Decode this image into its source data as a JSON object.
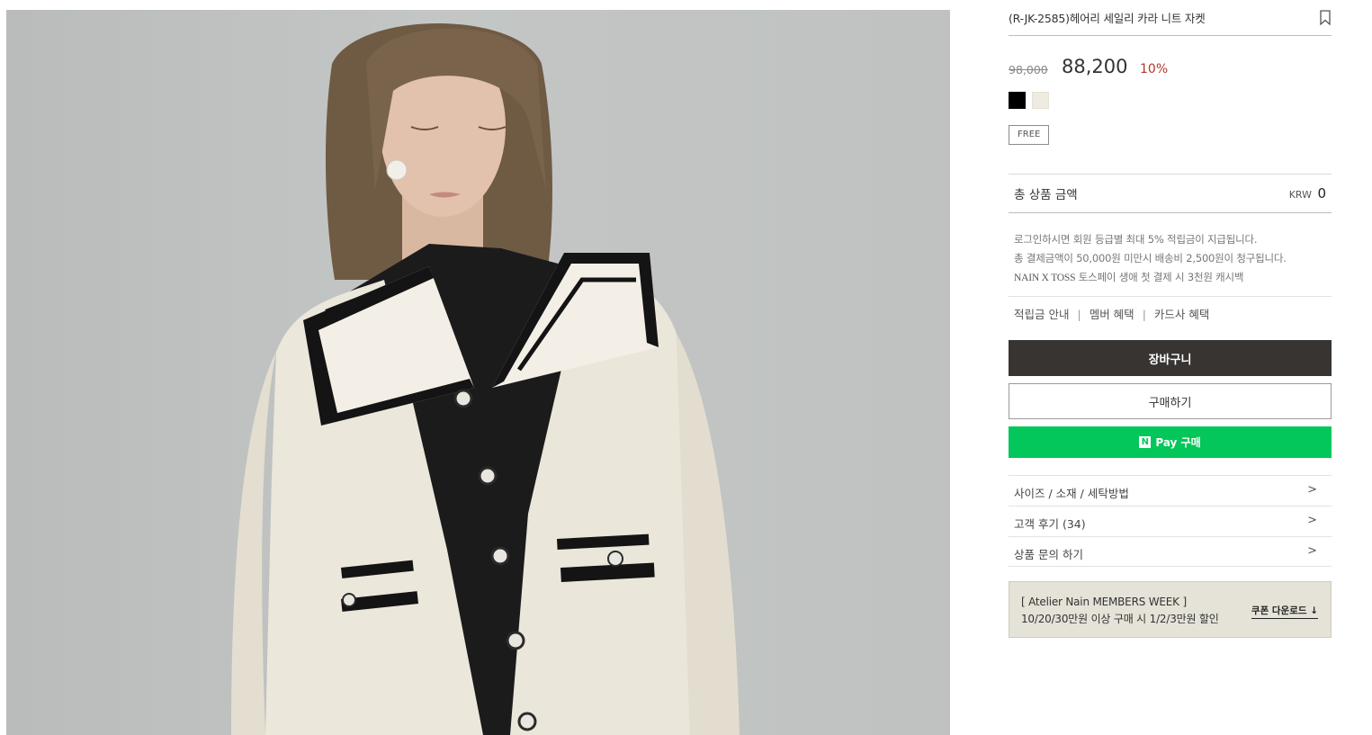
{
  "product": {
    "title": "(R-JK-2585)헤어리 세일리 카라 니트 자켓",
    "price_original": "98,000",
    "price_sale": "88,200",
    "discount": "10%",
    "colors": [
      {
        "name": "black",
        "hex": "#000000"
      },
      {
        "name": "ivory",
        "hex": "#efebe2"
      }
    ],
    "size_option": "FREE"
  },
  "total": {
    "label": "총 상품 금액",
    "currency": "KRW",
    "value": "0"
  },
  "notes": [
    "로그인하시면 회원 등급별 최대 5% 적립금이 지급됩니다.",
    "총 결제금액이 50,000원 미만시 배송비 2,500원이 청구됩니다.",
    {
      "brand": "NAIN X TOSS",
      "text": " 토스페이 생애 첫 결제 시 3천원 캐시백"
    }
  ],
  "benefits": {
    "links": [
      "적립금 안내",
      "멤버 혜택",
      "카드사 혜택"
    ],
    "separator": "|"
  },
  "buttons": {
    "cart": "장바구니",
    "buy": "구매하기",
    "npay_logo": "N",
    "npay": "Pay 구매"
  },
  "accordion": [
    {
      "label": "사이즈 / 소재 / 세탁방법",
      "arrow": ">"
    },
    {
      "label": "고객 후기 (34)",
      "arrow": ">"
    },
    {
      "label": "상품 문의 하기",
      "arrow": ">"
    }
  ],
  "banner": {
    "line1": "[ Atelier Nain MEMBERS WEEK ]",
    "line2": "10/20/30만원 이상 구매 시 1/2/3만원 할인",
    "coupon": "쿠폰 다운로드 ↓"
  },
  "colors": {
    "cart_button": "#383432",
    "npay_green": "#03c75a",
    "discount_red": "#b3382d",
    "banner_bg": "#e5e2d8"
  }
}
